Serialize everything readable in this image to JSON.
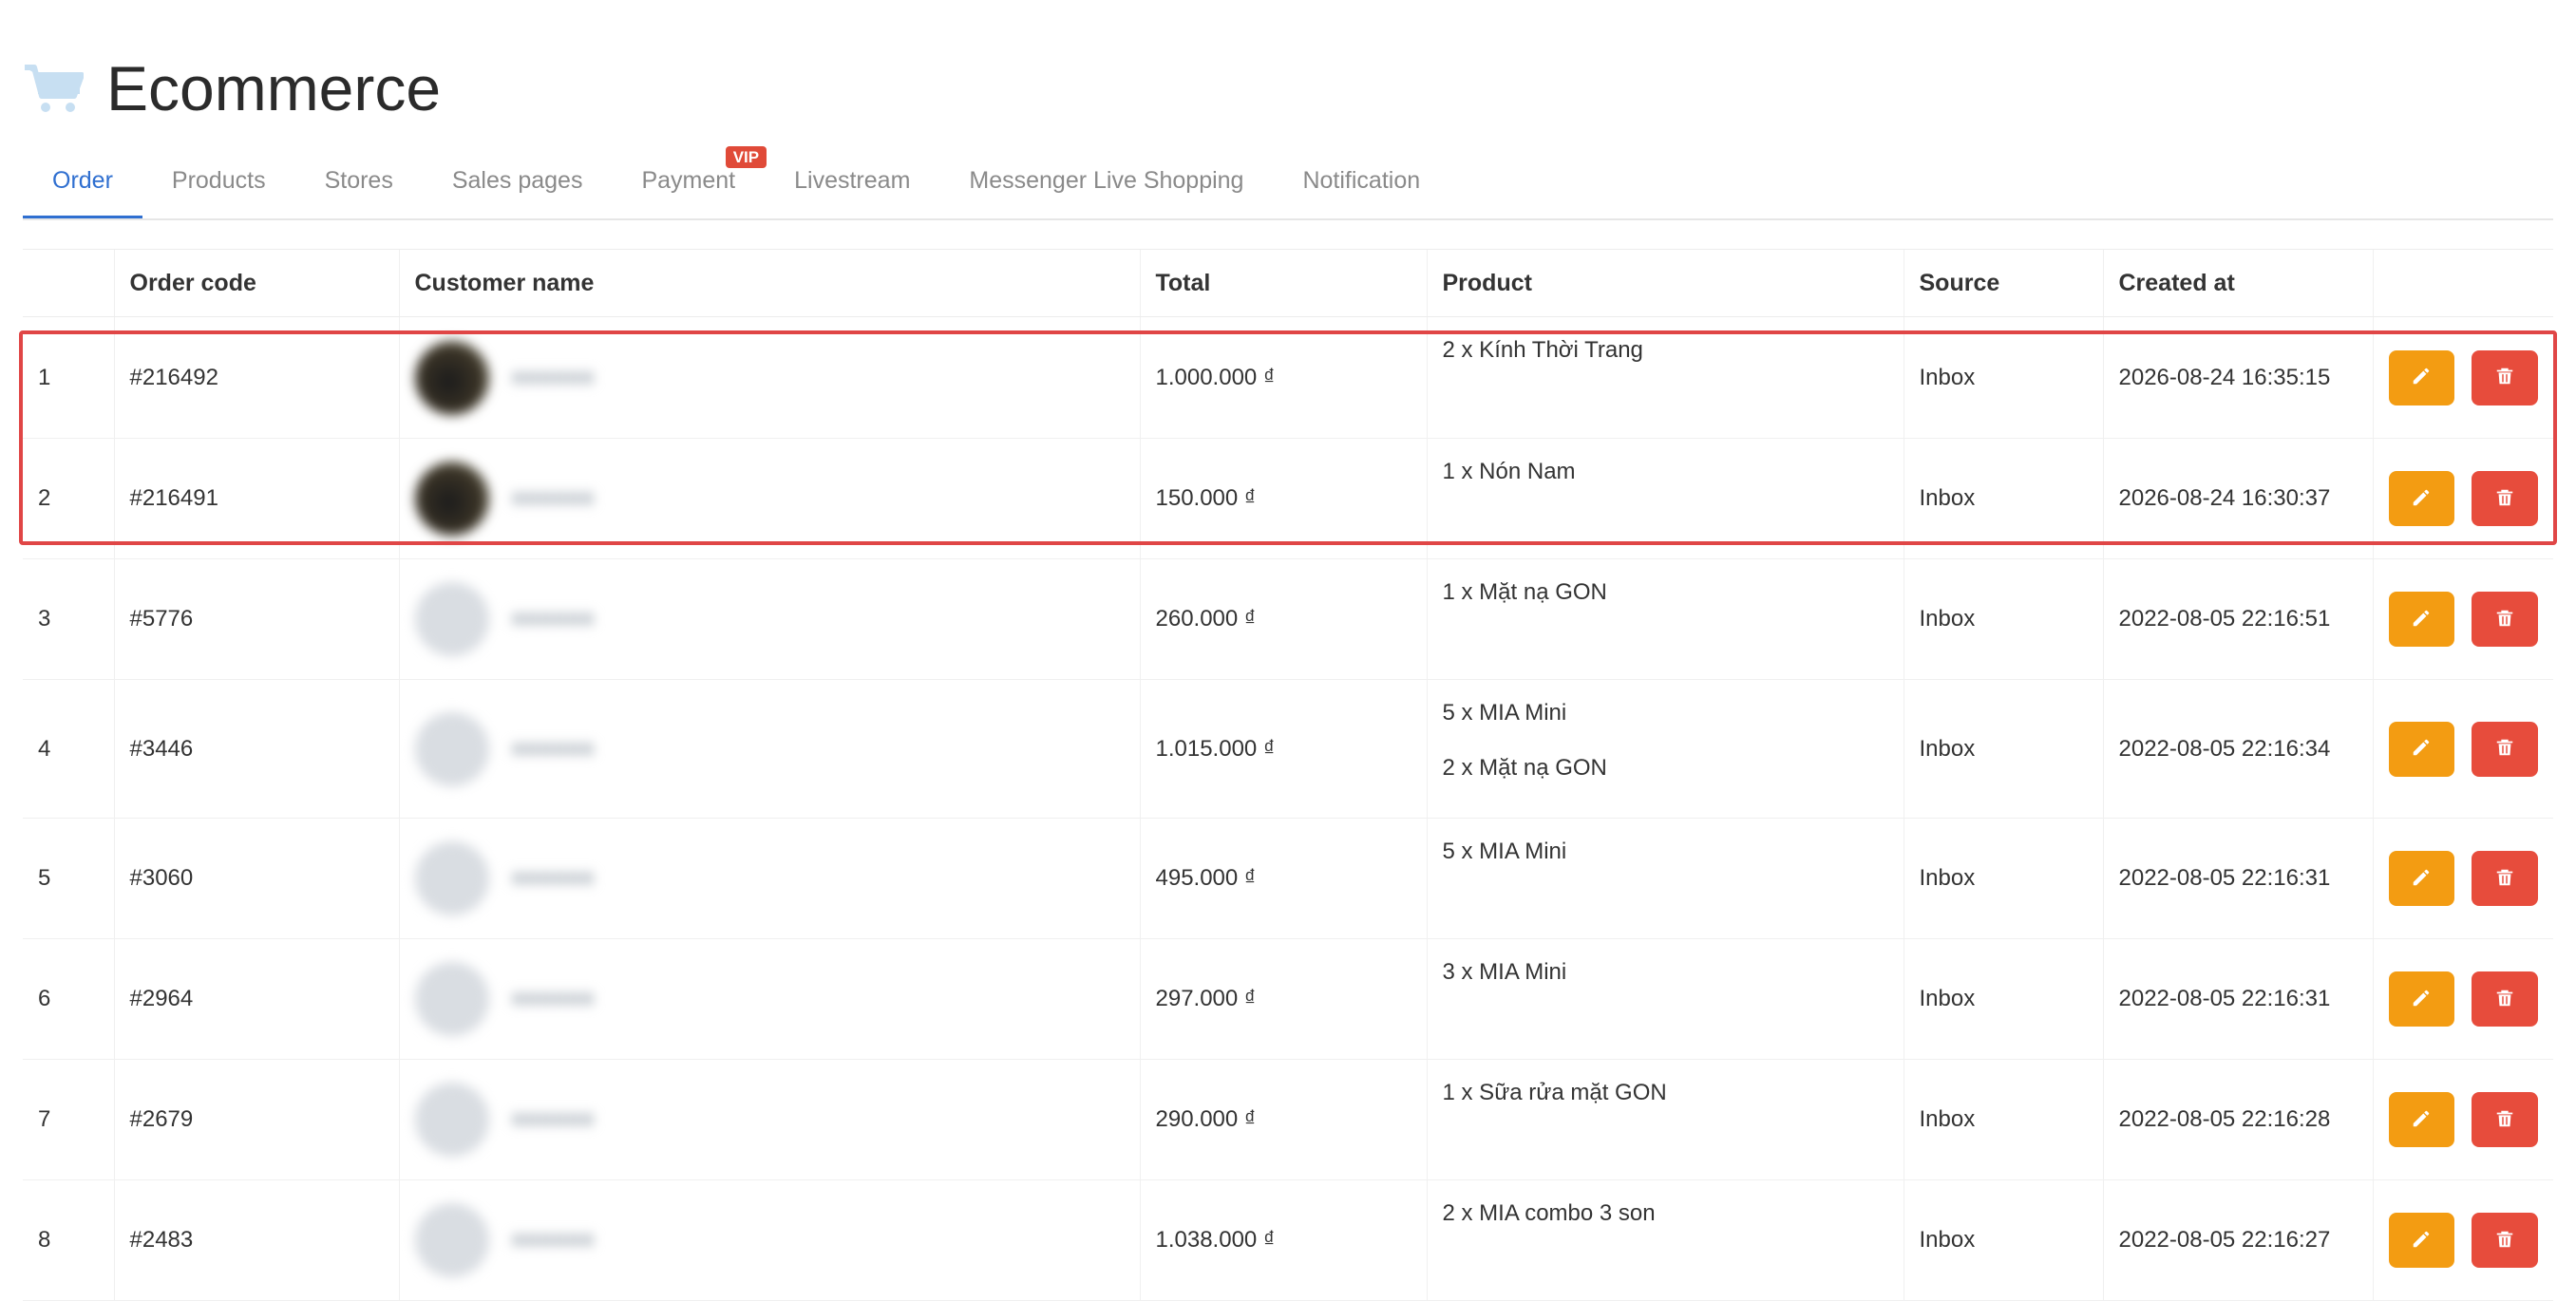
{
  "app": {
    "title": "Ecommerce",
    "icon": "cart-icon"
  },
  "tabs": [
    {
      "label": "Order",
      "active": true
    },
    {
      "label": "Products"
    },
    {
      "label": "Stores"
    },
    {
      "label": "Sales pages"
    },
    {
      "label": "Payment",
      "badge": "VIP"
    },
    {
      "label": "Livestream"
    },
    {
      "label": "Messenger Live Shopping"
    },
    {
      "label": "Notification"
    }
  ],
  "table": {
    "headers": [
      "",
      "Order code",
      "Customer name",
      "Total",
      "Product",
      "Source",
      "Created at",
      ""
    ],
    "rows": [
      {
        "index": "1",
        "code": "#216492",
        "total": "1.000.000 ₫",
        "products": [
          "2 x Kính Thời Trang"
        ],
        "source": "Inbox",
        "created": "2026-08-24 16:35:15"
      },
      {
        "index": "2",
        "code": "#216491",
        "total": "150.000 ₫",
        "products": [
          "1 x Nón Nam"
        ],
        "source": "Inbox",
        "created": "2026-08-24 16:30:37"
      },
      {
        "index": "3",
        "code": "#5776",
        "total": "260.000 ₫",
        "products": [
          "1 x Mặt nạ GON"
        ],
        "source": "Inbox",
        "created": "2022-08-05 22:16:51"
      },
      {
        "index": "4",
        "code": "#3446",
        "total": "1.015.000 ₫",
        "products": [
          "5 x MIA Mini",
          "2 x Mặt nạ GON"
        ],
        "source": "Inbox",
        "created": "2022-08-05 22:16:34"
      },
      {
        "index": "5",
        "code": "#3060",
        "total": "495.000 ₫",
        "products": [
          "5 x MIA Mini"
        ],
        "source": "Inbox",
        "created": "2022-08-05 22:16:31"
      },
      {
        "index": "6",
        "code": "#2964",
        "total": "297.000 ₫",
        "products": [
          "3 x MIA Mini"
        ],
        "source": "Inbox",
        "created": "2022-08-05 22:16:31"
      },
      {
        "index": "7",
        "code": "#2679",
        "total": "290.000 ₫",
        "products": [
          "1 x Sữa rửa mặt GON"
        ],
        "source": "Inbox",
        "created": "2022-08-05 22:16:28"
      },
      {
        "index": "8",
        "code": "#2483",
        "total": "1.038.000 ₫",
        "products": [
          "2 x MIA combo 3 son"
        ],
        "source": "Inbox",
        "created": "2022-08-05 22:16:27"
      }
    ]
  },
  "colors": {
    "accent": "#2f6fd0",
    "edit": "#f39c12",
    "delete": "#e74c3c",
    "highlight": "#e04646",
    "vip": "#e04a38"
  }
}
